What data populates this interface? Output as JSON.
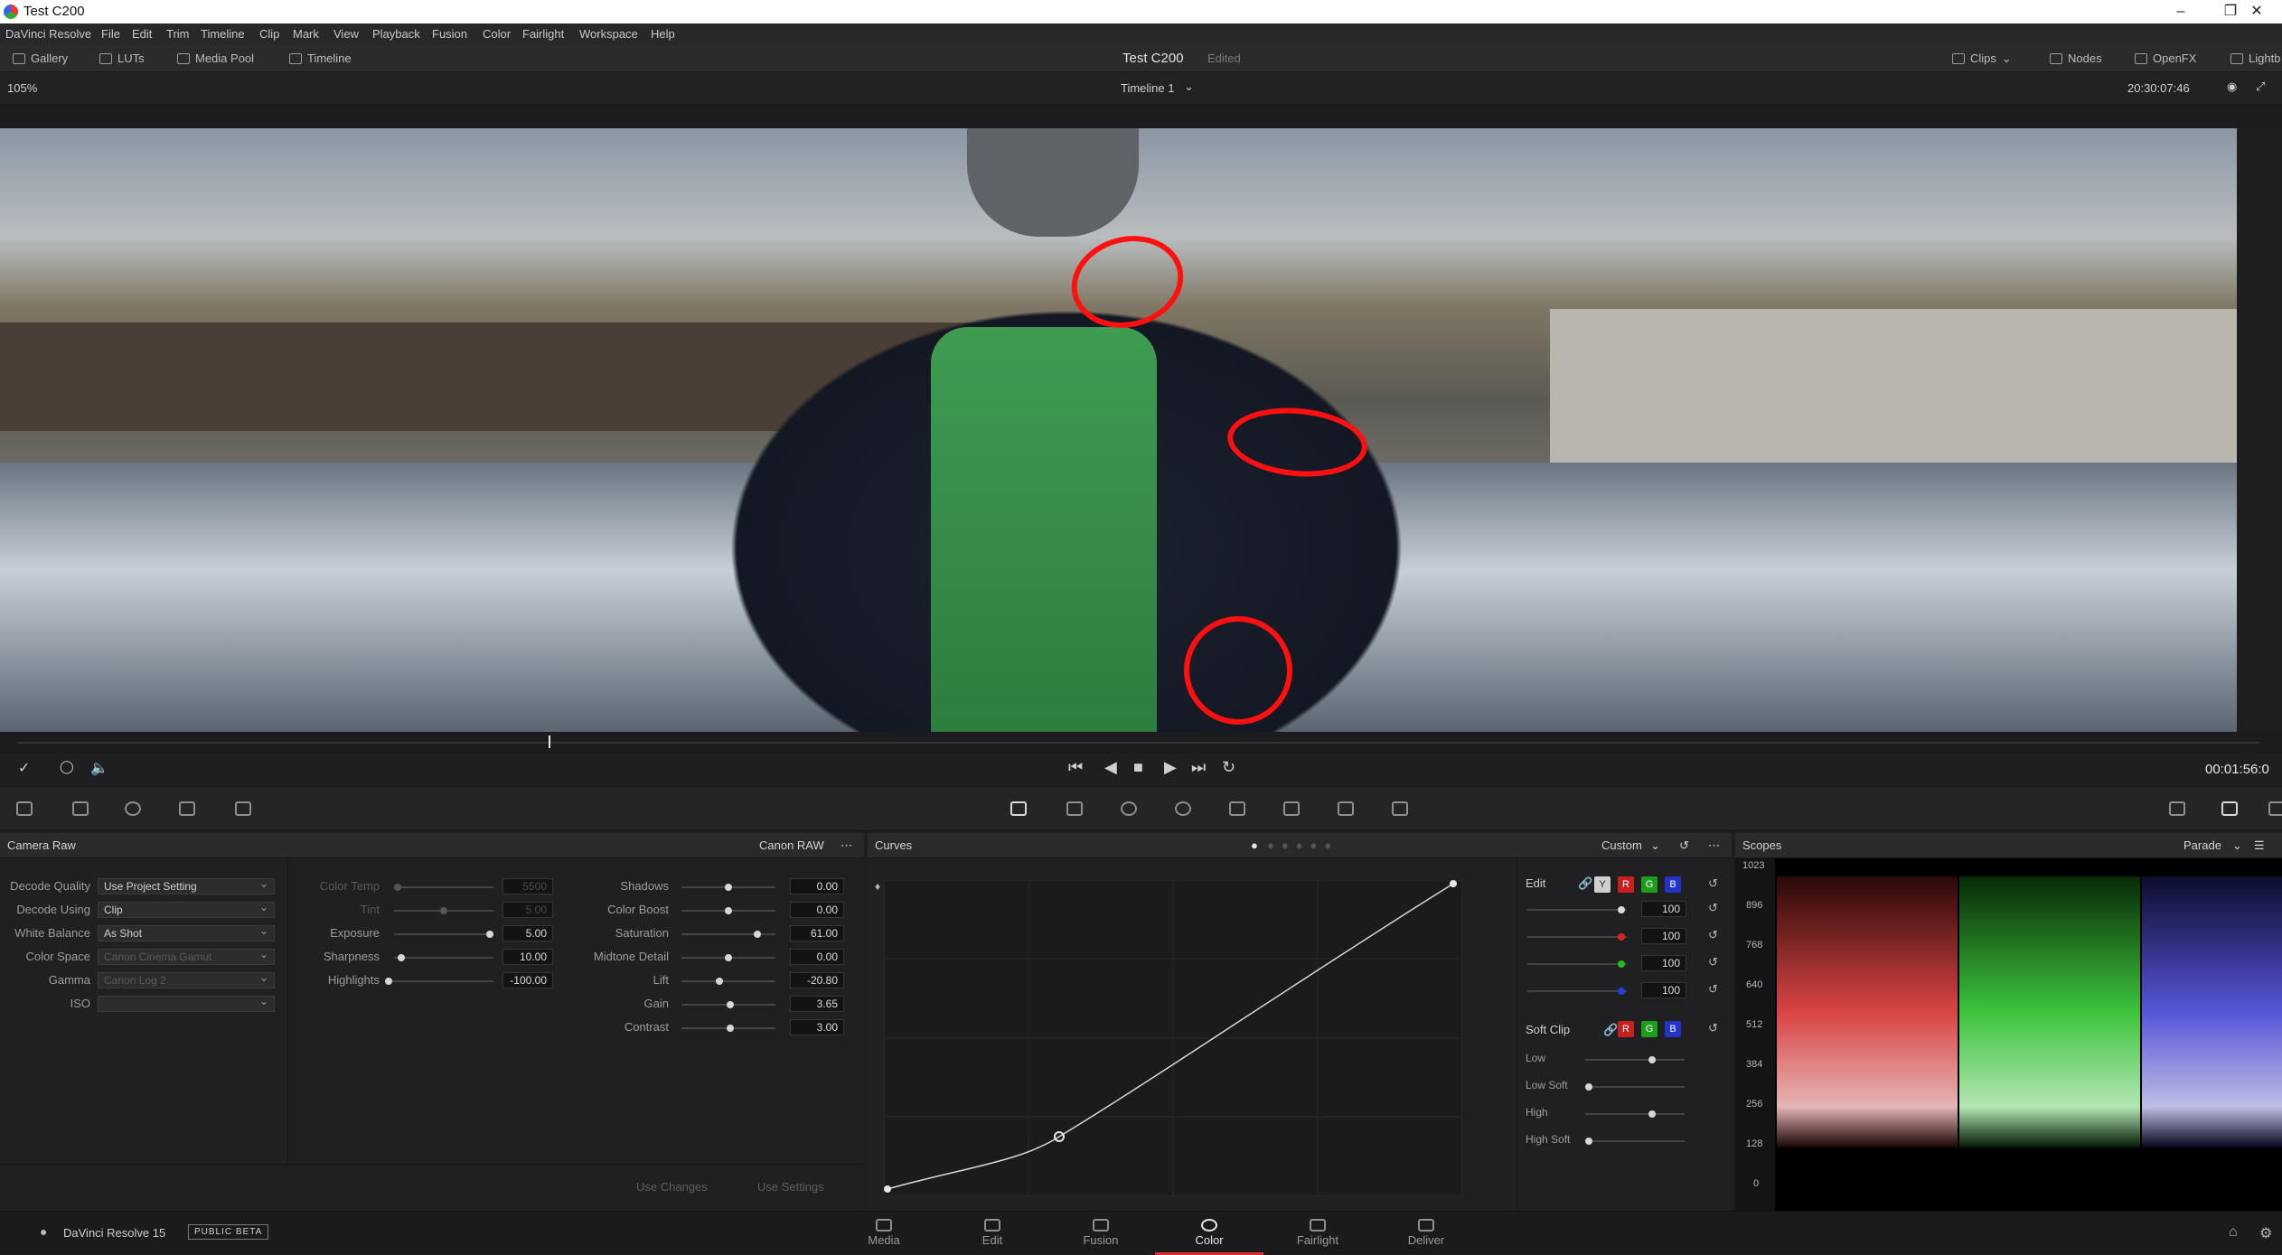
{
  "window": {
    "title": "Test C200",
    "controls": [
      "minimize-icon",
      "maximize-icon",
      "close-icon"
    ]
  },
  "menu": [
    "DaVinci Resolve",
    "File",
    "Edit",
    "Trim",
    "Timeline",
    "Clip",
    "Mark",
    "View",
    "Playback",
    "Fusion",
    "Color",
    "Fairlight",
    "Workspace",
    "Help"
  ],
  "toolbar": {
    "gallery": "Gallery",
    "luts": "LUTs",
    "media_pool": "Media Pool",
    "timeline": "Timeline",
    "project": "Test C200",
    "status": "Edited",
    "clips": "Clips",
    "nodes": "Nodes",
    "openfx": "OpenFX",
    "lightbox": "Lightb"
  },
  "viewer": {
    "zoom": "105%",
    "timeline_name": "Timeline 1",
    "timecode": "20:30:07:46"
  },
  "transport": {
    "timecode": "00:01:56:0"
  },
  "camera_raw": {
    "title": "Camera Raw",
    "format": "Canon RAW",
    "decode": [
      {
        "label": "Decode Quality",
        "value": "Use Project Setting",
        "enabled": true
      },
      {
        "label": "Decode Using",
        "value": "Clip",
        "enabled": true
      },
      {
        "label": "White Balance",
        "value": "As Shot",
        "enabled": true
      },
      {
        "label": "Color Space",
        "value": "Canon Cinema Gamut",
        "enabled": false
      },
      {
        "label": "Gamma",
        "value": "Canon Log 2",
        "enabled": false
      },
      {
        "label": "ISO",
        "value": "",
        "enabled": false
      }
    ],
    "mid": [
      {
        "label": "Color Temp",
        "value": "5500",
        "enabled": false,
        "level": 0.0
      },
      {
        "label": "Tint",
        "value": "5.00",
        "enabled": false,
        "level": 0.5
      },
      {
        "label": "Exposure",
        "value": "5.00",
        "enabled": true,
        "level": 1.0
      },
      {
        "label": "Sharpness",
        "value": "10.00",
        "enabled": true,
        "level": 0.05
      },
      {
        "label": "Highlights",
        "value": "-100.00",
        "enabled": true,
        "level": 0.0
      }
    ],
    "right": [
      {
        "label": "Shadows",
        "value": "0.00",
        "level": 0.5
      },
      {
        "label": "Color Boost",
        "value": "0.00",
        "level": 0.5
      },
      {
        "label": "Saturation",
        "value": "61.00",
        "level": 0.8
      },
      {
        "label": "Midtone Detail",
        "value": "0.00",
        "level": 0.5
      },
      {
        "label": "Lift",
        "value": "-20.80",
        "level": 0.4
      },
      {
        "label": "Gain",
        "value": "3.65",
        "level": 0.51
      },
      {
        "label": "Contrast",
        "value": "3.00",
        "level": 0.51
      }
    ],
    "use_changes": "Use Changes",
    "use_settings": "Use Settings"
  },
  "curves": {
    "title": "Curves",
    "mode": "Custom",
    "edit_label": "Edit",
    "channels": [
      {
        "value": "100",
        "color": "#dcdcdc"
      },
      {
        "value": "100",
        "color": "#e02020"
      },
      {
        "value": "100",
        "color": "#20c020"
      },
      {
        "value": "100",
        "color": "#2040e0"
      }
    ],
    "soft_clip": {
      "label": "Soft Clip",
      "items": [
        {
          "label": "Low",
          "level": 0.65
        },
        {
          "label": "Low Soft",
          "level": 0.0
        },
        {
          "label": "High",
          "level": 0.65
        },
        {
          "label": "High Soft",
          "level": 0.0
        }
      ]
    },
    "channel_buttons": [
      "Y",
      "R",
      "G",
      "B"
    ]
  },
  "scopes": {
    "title": "Scopes",
    "mode": "Parade",
    "scale": [
      "1023",
      "896",
      "768",
      "640",
      "512",
      "384",
      "256",
      "128",
      "0"
    ]
  },
  "footer": {
    "app": "DaVinci Resolve 15",
    "badge": "PUBLIC BETA"
  },
  "pages": [
    {
      "label": "Media",
      "active": false
    },
    {
      "label": "Edit",
      "active": false
    },
    {
      "label": "Fusion",
      "active": false
    },
    {
      "label": "Color",
      "active": true
    },
    {
      "label": "Fairlight",
      "active": false
    },
    {
      "label": "Deliver",
      "active": false
    }
  ]
}
